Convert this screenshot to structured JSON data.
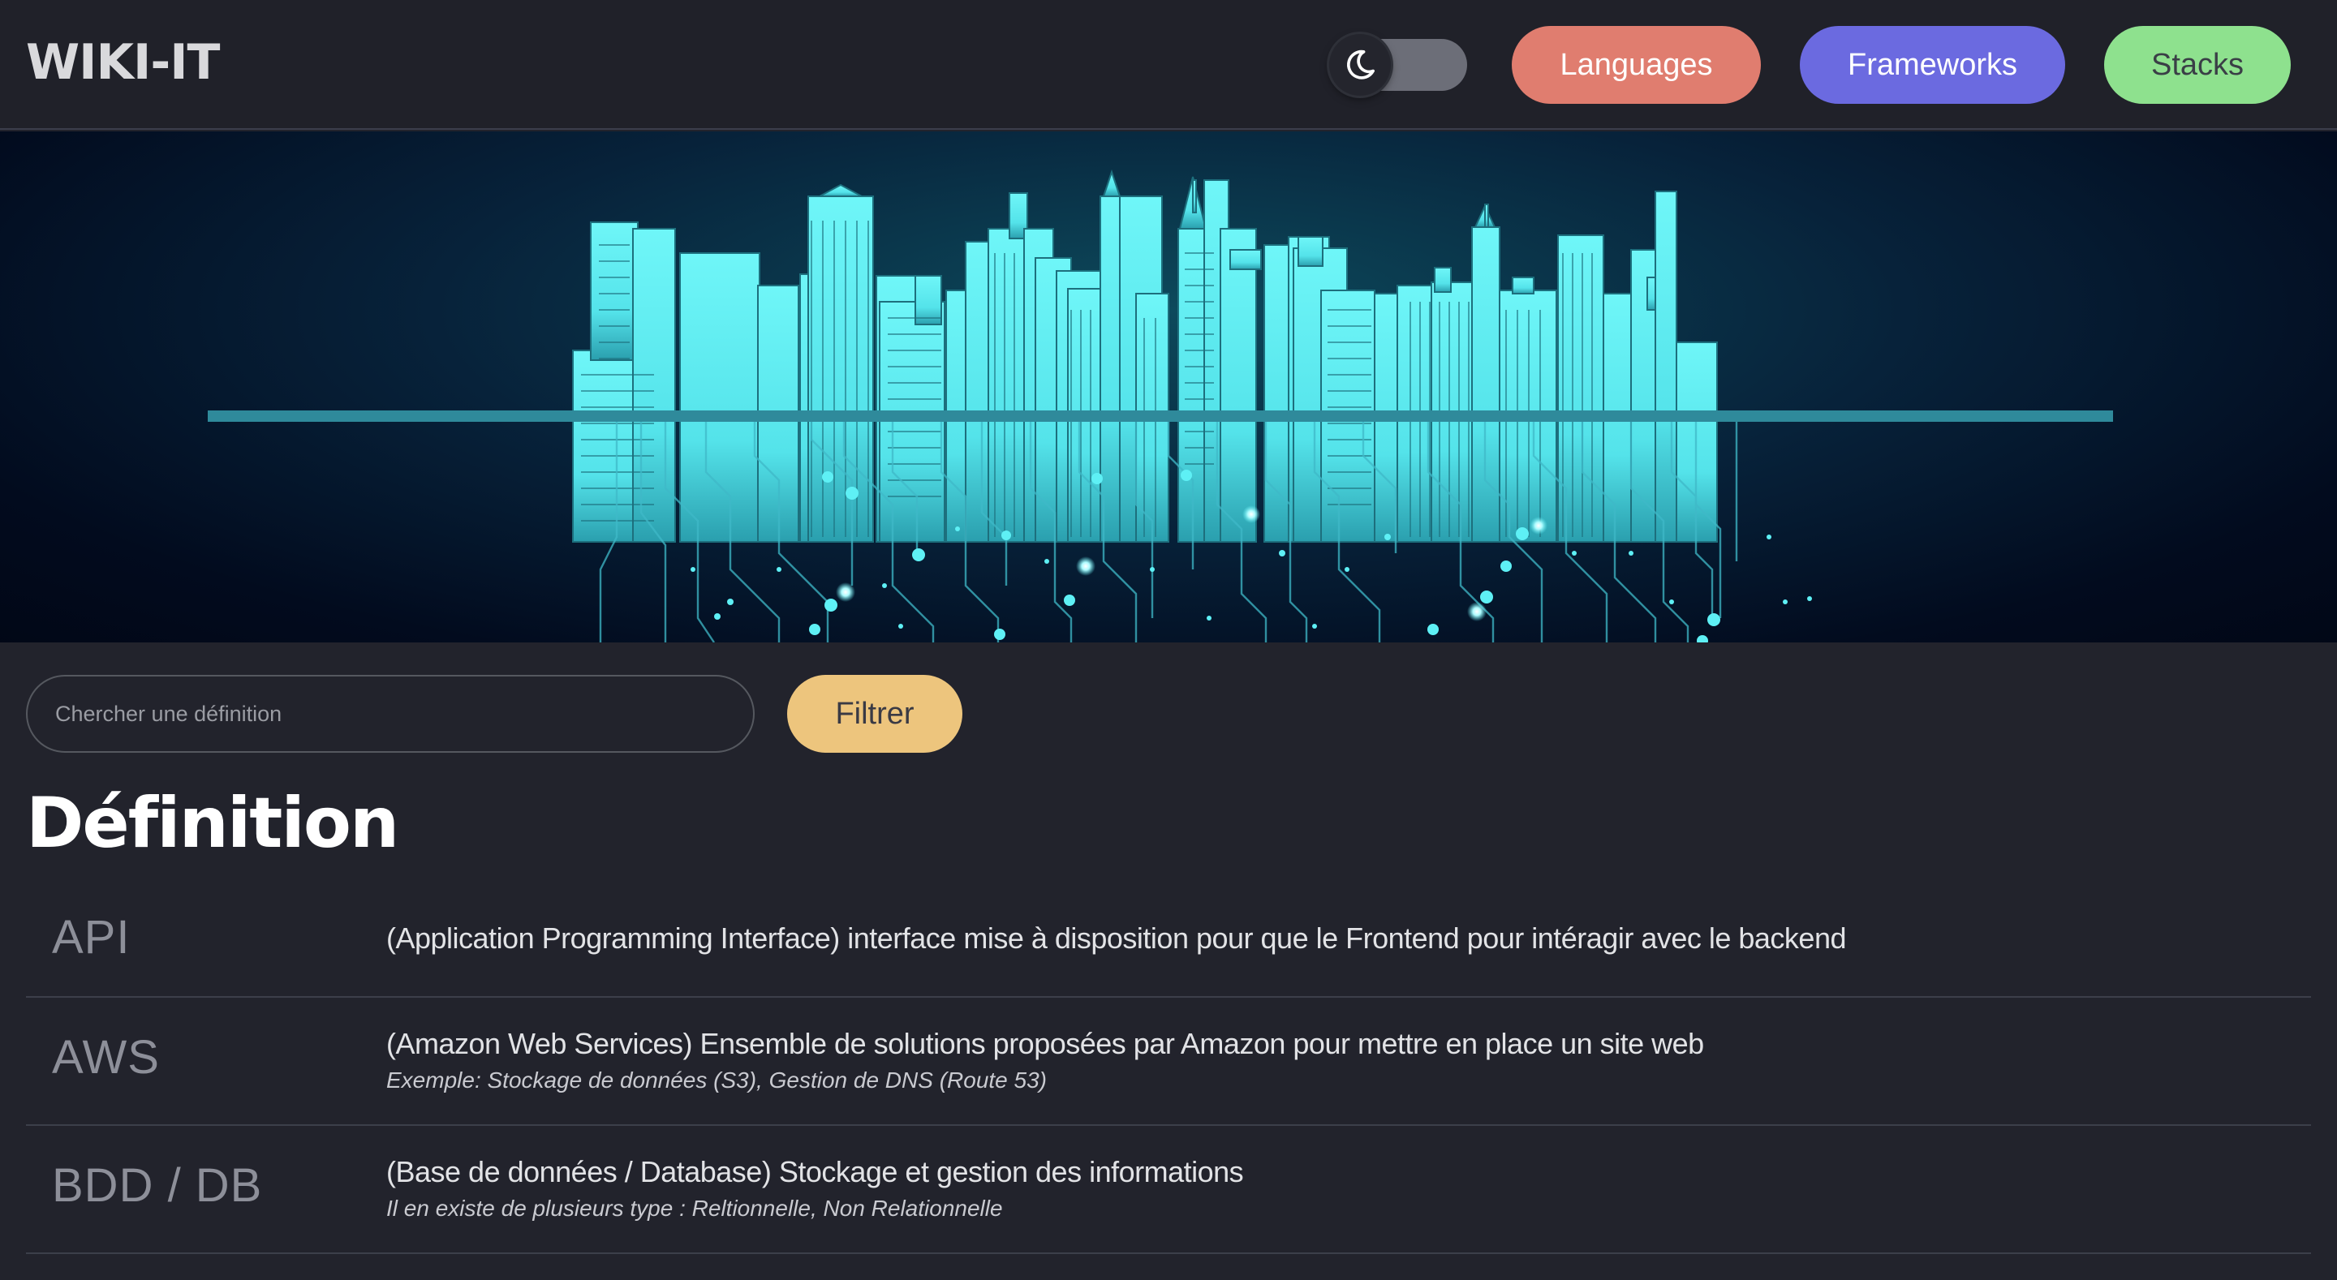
{
  "header": {
    "logo": "WIKI-IT",
    "theme_toggle": {
      "icon": "moon-icon",
      "state": "dark"
    },
    "nav": [
      {
        "label": "Languages",
        "color": "#e07d6f"
      },
      {
        "label": "Frameworks",
        "color": "#6b6ae0"
      },
      {
        "label": "Stacks",
        "color": "#8ee18e"
      }
    ]
  },
  "hero": {
    "image": "city-skyline-circuit-board-illustration"
  },
  "search": {
    "placeholder": "Chercher une définition",
    "value": "",
    "button_label": "Filtrer"
  },
  "definitions": {
    "title": "Définition",
    "items": [
      {
        "term": "API",
        "description": "(Application Programming Interface) interface mise à disposition pour que le Frontend pour intéragir avec le backend",
        "example": ""
      },
      {
        "term": "AWS",
        "description": "(Amazon Web Services) Ensemble de solutions proposées par Amazon pour mettre en place un site web",
        "example": "Exemple: Stockage de données (S3), Gestion de DNS (Route 53)"
      },
      {
        "term": "BDD / DB",
        "description": "(Base de données / Database) Stockage et gestion des informations",
        "example": "Il en existe de plusieurs type : Reltionnelle, Non Relationnelle"
      }
    ]
  },
  "colors": {
    "background": "#22232c",
    "accent_filter": "#edc57d",
    "hero_cyan": "#5ef0f5"
  }
}
